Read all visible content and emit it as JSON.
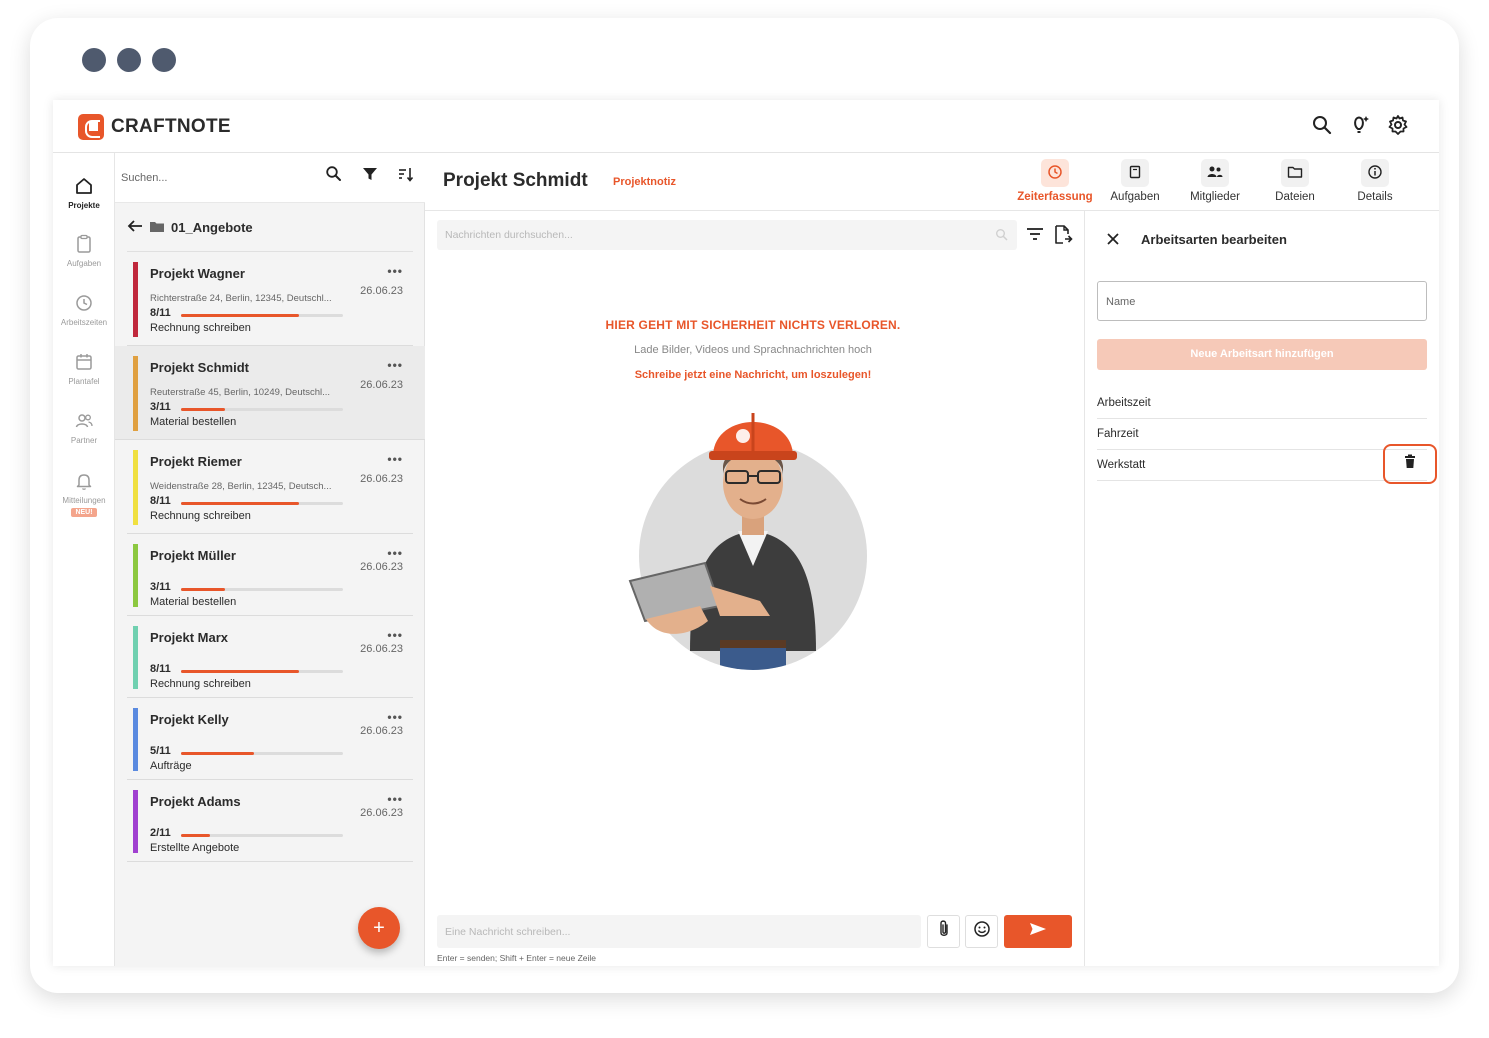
{
  "window": {
    "controls": [
      "dot",
      "dot",
      "dot"
    ]
  },
  "app": {
    "brand": "CRAFTNOTE",
    "accent": "#e8562a",
    "top_icons": [
      "search-icon",
      "lightbulb-icon",
      "gear-icon"
    ]
  },
  "nav": {
    "items": [
      {
        "label": "Projekte",
        "icon": "home-icon",
        "active": true
      },
      {
        "label": "Aufgaben",
        "icon": "clipboard-icon"
      },
      {
        "label": "Arbeitszeiten",
        "icon": "clock-icon"
      },
      {
        "label": "Plantafel",
        "icon": "calendar-icon"
      },
      {
        "label": "Partner",
        "icon": "people-icon"
      },
      {
        "label": "Mitteilungen",
        "icon": "bell-icon",
        "badge": "NEU!"
      }
    ]
  },
  "projects_panel": {
    "search_placeholder": "Suchen...",
    "folder": "01_Angebote",
    "fab_label": "+",
    "projects": [
      {
        "name": "Projekt Wagner",
        "more": "•••",
        "date": "26.06.23",
        "address": "Richterstraße 24, Berlin, 12345, Deutschl...",
        "progress": "8/11",
        "progress_fraction": 0.73,
        "status": "Rechnung schreiben",
        "color": "#c0283c"
      },
      {
        "name": "Projekt Schmidt",
        "more": "•••",
        "date": "26.06.23",
        "address": "Reuterstraße 45, Berlin, 10249, Deutschl...",
        "progress": "3/11",
        "progress_fraction": 0.27,
        "status": "Material bestellen",
        "color": "#e0a040",
        "selected": true
      },
      {
        "name": "Projekt Riemer",
        "more": "•••",
        "date": "26.06.23",
        "address": "Weidenstraße 28, Berlin, 12345, Deutsch...",
        "progress": "8/11",
        "progress_fraction": 0.73,
        "status": "Rechnung schreiben",
        "color": "#f0e040"
      },
      {
        "name": "Projekt Müller",
        "more": "•••",
        "date": "26.06.23",
        "address": "",
        "progress": "3/11",
        "progress_fraction": 0.27,
        "status": "Material bestellen",
        "color": "#8cc840"
      },
      {
        "name": "Projekt Marx",
        "more": "•••",
        "date": "26.06.23",
        "address": "",
        "progress": "8/11",
        "progress_fraction": 0.73,
        "status": "Rechnung schreiben",
        "color": "#70d0b0"
      },
      {
        "name": "Projekt Kelly",
        "more": "•••",
        "date": "26.06.23",
        "address": "",
        "progress": "5/11",
        "progress_fraction": 0.45,
        "status": "Aufträge",
        "color": "#5a8ae0"
      },
      {
        "name": "Projekt Adams",
        "more": "•••",
        "date": "26.06.23",
        "address": "",
        "progress": "2/11",
        "progress_fraction": 0.18,
        "status": "Erstellte Angebote",
        "color": "#a040d0"
      }
    ]
  },
  "project": {
    "title": "Projekt Schmidt",
    "tag": "Projektnotiz",
    "tabs": [
      {
        "label": "Zeiterfassung",
        "icon": "clock-icon",
        "active": true
      },
      {
        "label": "Aufgaben",
        "icon": "clipboard-icon"
      },
      {
        "label": "Mitglieder",
        "icon": "members-icon"
      },
      {
        "label": "Dateien",
        "icon": "folder-icon"
      },
      {
        "label": "Details",
        "icon": "info-icon"
      }
    ]
  },
  "chat": {
    "search_placeholder": "Nachrichten durchsuchen...",
    "empty_heading": "HIER GEHT MIT SICHERHEIT NICHTS VERLOREN.",
    "empty_sub": "Lade Bilder, Videos und Sprachnachrichten hoch",
    "empty_cta": "Schreibe jetzt eine Nachricht, um loszulegen!",
    "composer_placeholder": "Eine Nachricht schreiben...",
    "hint": "Enter = senden; Shift + Enter = neue Zeile"
  },
  "work_types": {
    "title": "Arbeitsarten bearbeiten",
    "name_placeholder": "Name",
    "add_button": "Neue Arbeitsart hinzufügen",
    "items": [
      "Arbeitszeit",
      "Fahrzeit",
      "Werkstatt"
    ]
  }
}
